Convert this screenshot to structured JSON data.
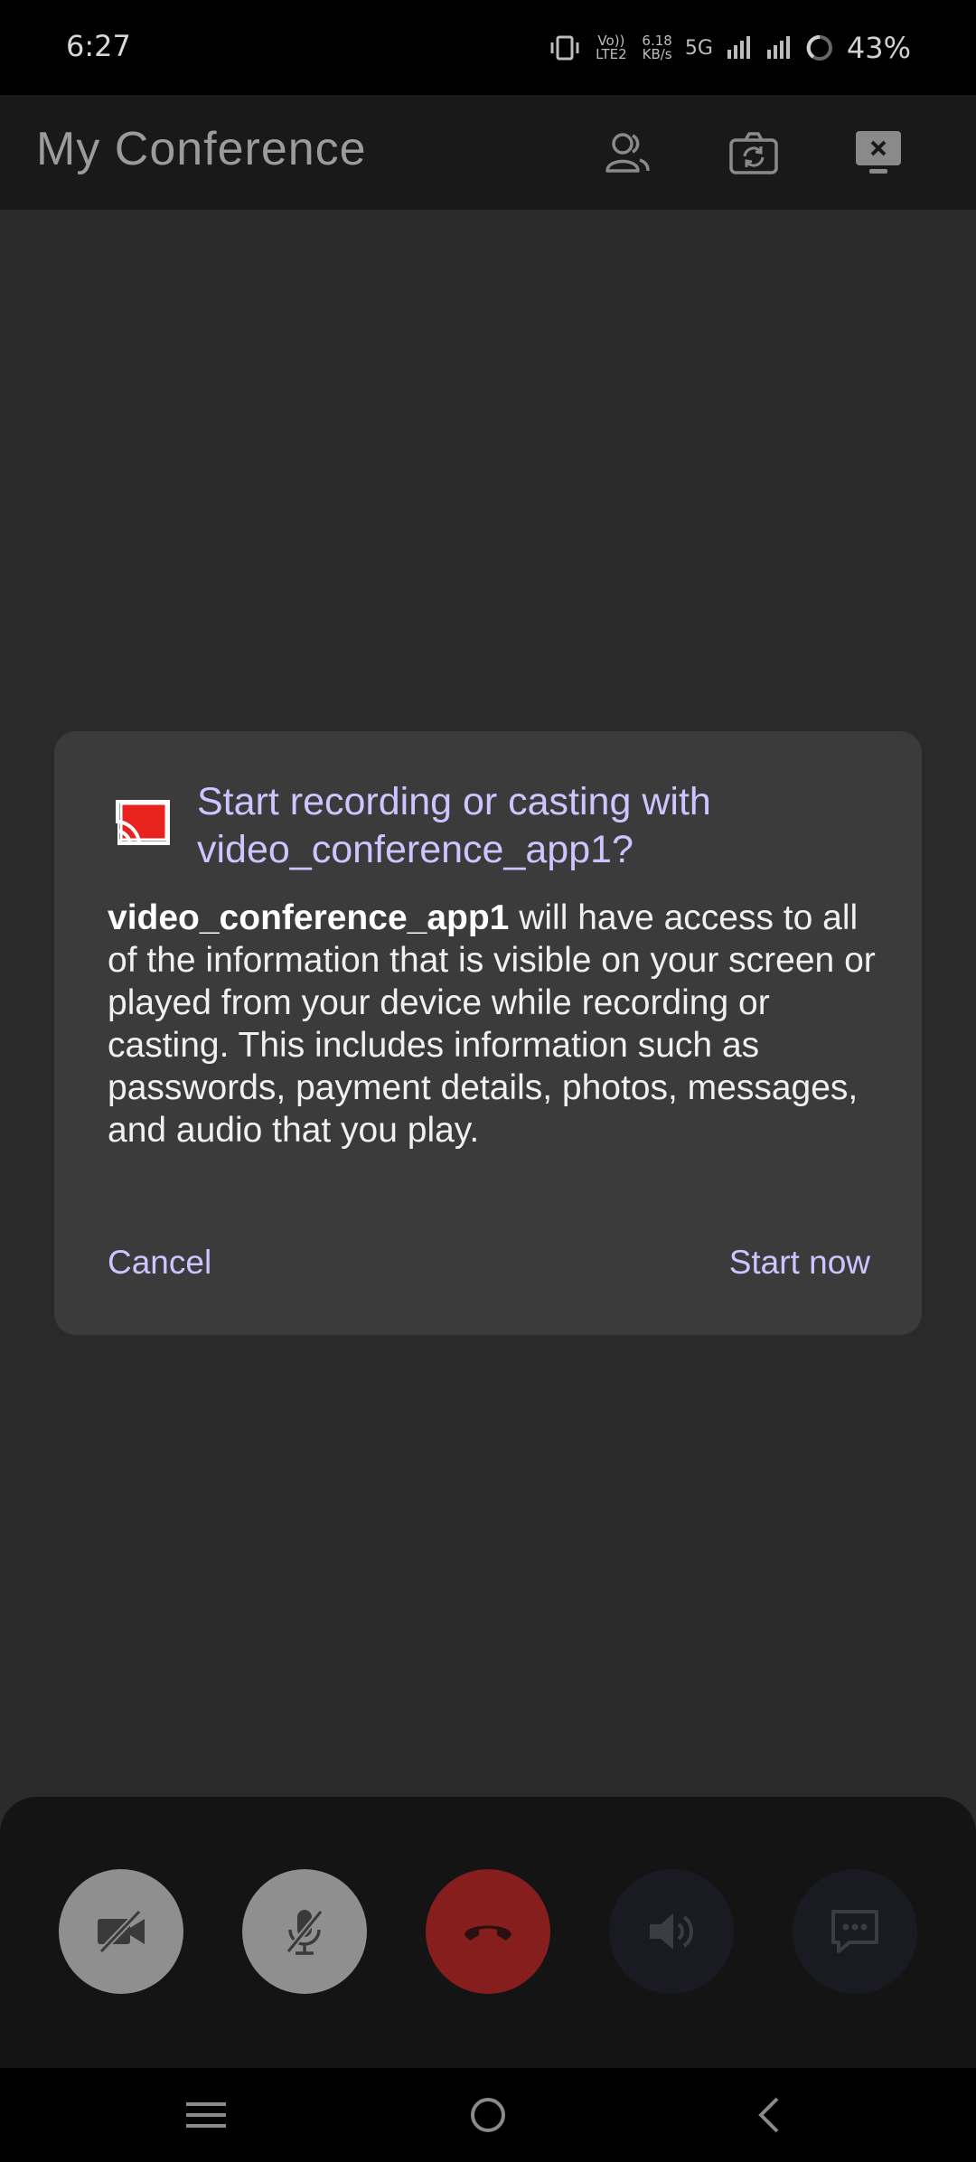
{
  "status_bar": {
    "time": "6:27",
    "volte": "Vo)) LTE2",
    "speed_value": "6.18",
    "speed_unit": "KB/s",
    "network": "5G",
    "battery": "43%"
  },
  "app_bar": {
    "title": "My Conference",
    "icons": [
      "participants-icon",
      "switch-camera-icon",
      "stop-screen-share-icon"
    ]
  },
  "dialog": {
    "title": "Start recording or casting with video_conference_app1?",
    "body_app_name": "video_conference_app1",
    "body_text": " will have access to all of the information that is visible on your screen or played from your device while recording or casting. This includes information such as passwords, payment details, photos, messages, and audio that you play.",
    "cancel_label": "Cancel",
    "start_label": "Start now",
    "icon": "cast-icon",
    "accent": "#cfc4ff"
  },
  "call_controls": {
    "icons": [
      "video-off-icon",
      "mic-off-icon",
      "end-call-icon",
      "speaker-icon",
      "chat-icon"
    ],
    "end_call_color": "#861e1e"
  },
  "nav_bar": {
    "icons": [
      "recents-icon",
      "home-icon",
      "back-icon"
    ]
  }
}
